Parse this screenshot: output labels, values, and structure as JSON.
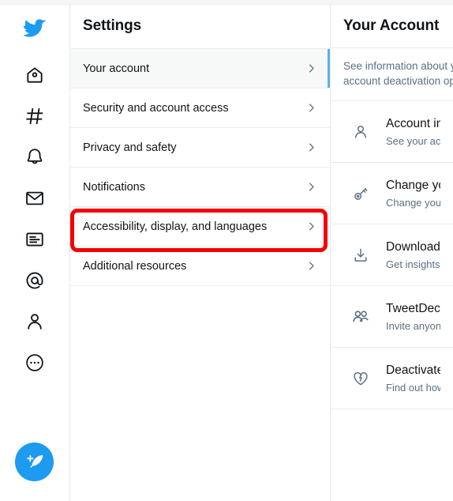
{
  "nav": {
    "items": [
      {
        "name": "twitter-logo-icon",
        "label": "Twitter"
      },
      {
        "name": "home-icon",
        "label": "Home"
      },
      {
        "name": "explore-hashtag-icon",
        "label": "Explore"
      },
      {
        "name": "notifications-bell-icon",
        "label": "Notifications"
      },
      {
        "name": "messages-envelope-icon",
        "label": "Messages"
      },
      {
        "name": "lists-icon",
        "label": "Lists"
      },
      {
        "name": "mentions-at-icon",
        "label": "Mentions"
      },
      {
        "name": "profile-person-icon",
        "label": "Profile"
      },
      {
        "name": "more-ellipsis-icon",
        "label": "More"
      }
    ],
    "compose": {
      "name": "compose-tweet-button",
      "label": "Tweet"
    }
  },
  "settings": {
    "title": "Settings",
    "rows": [
      {
        "label": "Your account",
        "selected": true,
        "highlighted": false
      },
      {
        "label": "Security and account access",
        "selected": false,
        "highlighted": false
      },
      {
        "label": "Privacy and safety",
        "selected": false,
        "highlighted": false
      },
      {
        "label": "Notifications",
        "selected": false,
        "highlighted": false
      },
      {
        "label": "Accessibility, display, and languages",
        "selected": false,
        "highlighted": true
      },
      {
        "label": "Additional resources",
        "selected": false,
        "highlighted": false
      }
    ],
    "chevron": "›"
  },
  "detail": {
    "title": "Your Account",
    "description_line1": "See information about y",
    "description_line2": "account deactivation op",
    "rows": [
      {
        "icon": "person-icon",
        "title": "Account in",
        "subtitle": "See your acc"
      },
      {
        "icon": "key-icon",
        "title": "Change yo",
        "subtitle": "Change you"
      },
      {
        "icon": "download-icon",
        "title": "Download",
        "subtitle": "Get insights"
      },
      {
        "icon": "people-group-icon",
        "title": "TweetDeck",
        "subtitle": "Invite anyon"
      },
      {
        "icon": "broken-heart-icon",
        "title": "Deactivate",
        "subtitle": "Find out how"
      }
    ]
  },
  "annotation": {
    "name": "red-highlight-box",
    "target": "Accessibility, display, and languages",
    "color": "#f50000"
  },
  "colors": {
    "accent": "#1d9bf0",
    "selected_indicator": "#5ab0ef",
    "text_primary": "#0f1419",
    "text_secondary": "#5b7083",
    "divider": "#eaeced",
    "selected_bg": "#f7f9f9"
  }
}
